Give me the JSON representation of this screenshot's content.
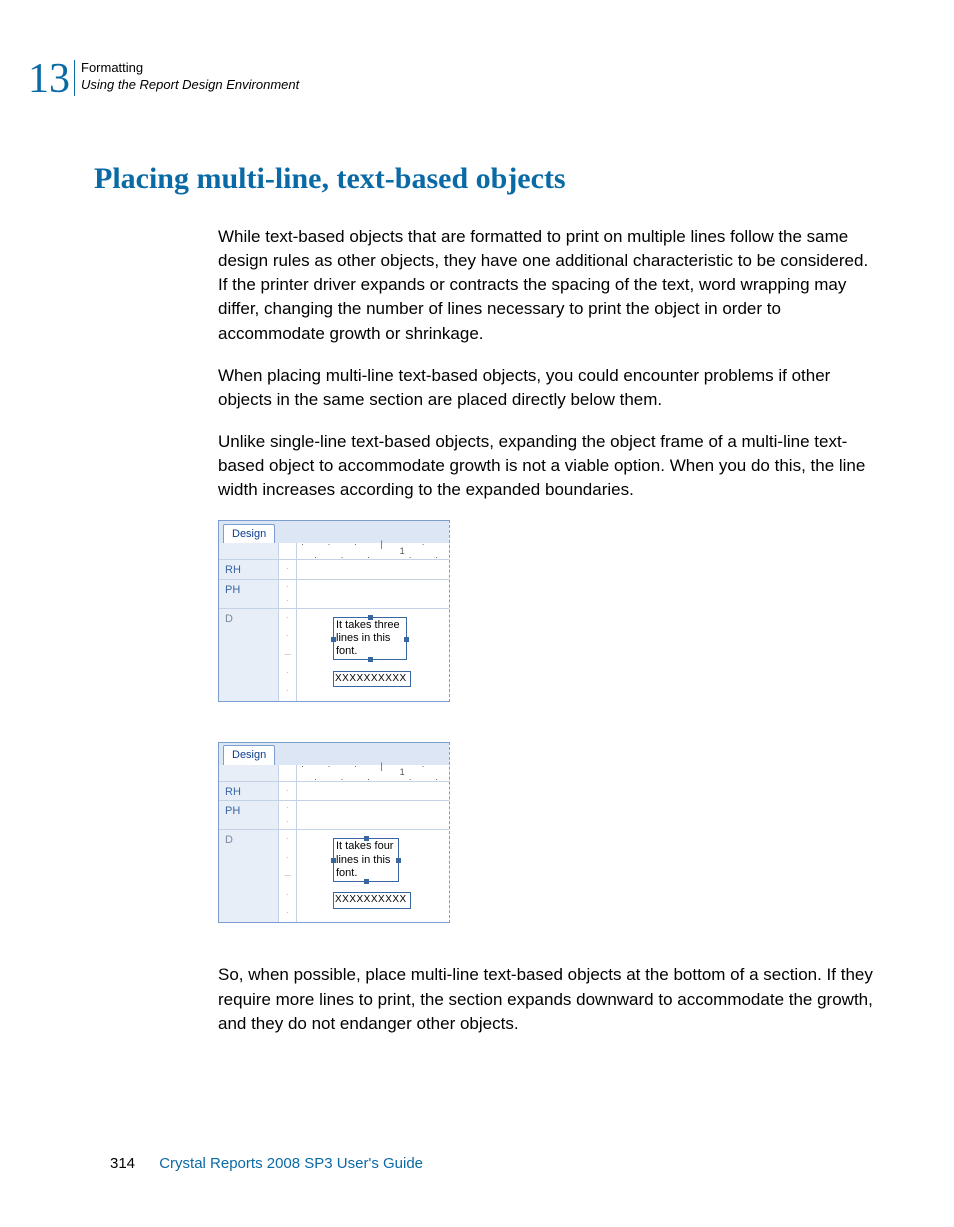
{
  "header": {
    "chapter_number": "13",
    "category": "Formatting",
    "subcategory": "Using the Report Design Environment"
  },
  "heading": "Placing multi-line, text-based objects",
  "paragraphs": {
    "p1": "While text-based objects that are formatted to print on multiple lines follow the same design rules as other objects, they have one additional characteristic to be considered. If the printer driver expands or contracts the spacing of the text, word wrapping may differ, changing the number of lines necessary to print the object in order to accommodate growth or shrinkage.",
    "p2": "When placing multi-line text-based objects, you could encounter problems if other objects in the same section are placed directly below them.",
    "p3": "Unlike single-line text-based objects, expanding the object frame of a multi-line text-based object to accommodate growth is not a viable option. When you do this, the line width increases according to the expanded boundaries.",
    "p4": "So, when possible, place multi-line text-based objects at the bottom of a section. If they require more lines to print, the section expands downward to accommodate the growth, and they do not endanger other objects."
  },
  "design_panel": {
    "tab": "Design",
    "ruler_mark": "1",
    "sections": {
      "rh": "RH",
      "ph": "PH",
      "d": "D"
    },
    "example1": {
      "text": "It takes three lines in this font.",
      "xrow": "XXXXXXXXXX"
    },
    "example2": {
      "text": "It takes four lines in this font.",
      "xrow": "XXXXXXXXXX"
    }
  },
  "footer": {
    "page": "314",
    "title": "Crystal Reports 2008 SP3 User's Guide"
  }
}
